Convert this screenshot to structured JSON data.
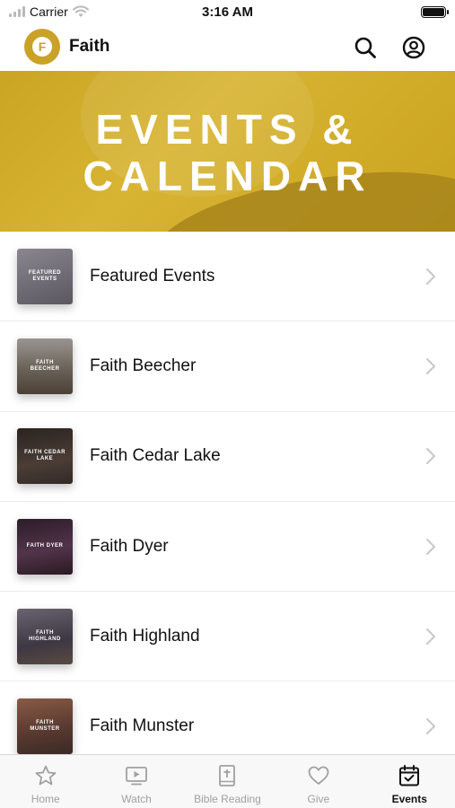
{
  "status_bar": {
    "carrier": "Carrier",
    "time": "3:16 AM"
  },
  "header": {
    "logo_letter": "F",
    "title": "Faith",
    "search_icon": "search-icon",
    "account_icon": "account-icon"
  },
  "banner": {
    "line1": "EVENTS &",
    "line2": "CALENDAR",
    "color": "#caa524"
  },
  "list": {
    "items": [
      {
        "label": "Featured Events",
        "thumb_text": "FEATURED EVENTS",
        "thumb_color": "#6d6a70"
      },
      {
        "label": "Faith Beecher",
        "thumb_text": "FAITH BEECHER",
        "thumb_color": "#5c554a"
      },
      {
        "label": "Faith Cedar Lake",
        "thumb_text": "FAITH CEDAR LAKE",
        "thumb_color": "#3b3330"
      },
      {
        "label": "Faith Dyer",
        "thumb_text": "FAITH DYER",
        "thumb_color": "#3e2a35"
      },
      {
        "label": "Faith Highland",
        "thumb_text": "FAITH HIGHLAND",
        "thumb_color": "#4a4650"
      },
      {
        "label": "Faith Munster",
        "thumb_text": "FAITH MUNSTER",
        "thumb_color": "#6b4a3a"
      }
    ]
  },
  "tab_bar": {
    "tabs": [
      {
        "label": "Home",
        "icon": "star-icon"
      },
      {
        "label": "Watch",
        "icon": "tv-play-icon"
      },
      {
        "label": "Bible Reading",
        "icon": "bible-icon"
      },
      {
        "label": "Give",
        "icon": "heart-icon"
      },
      {
        "label": "Events",
        "icon": "calendar-icon",
        "active": true
      }
    ]
  }
}
